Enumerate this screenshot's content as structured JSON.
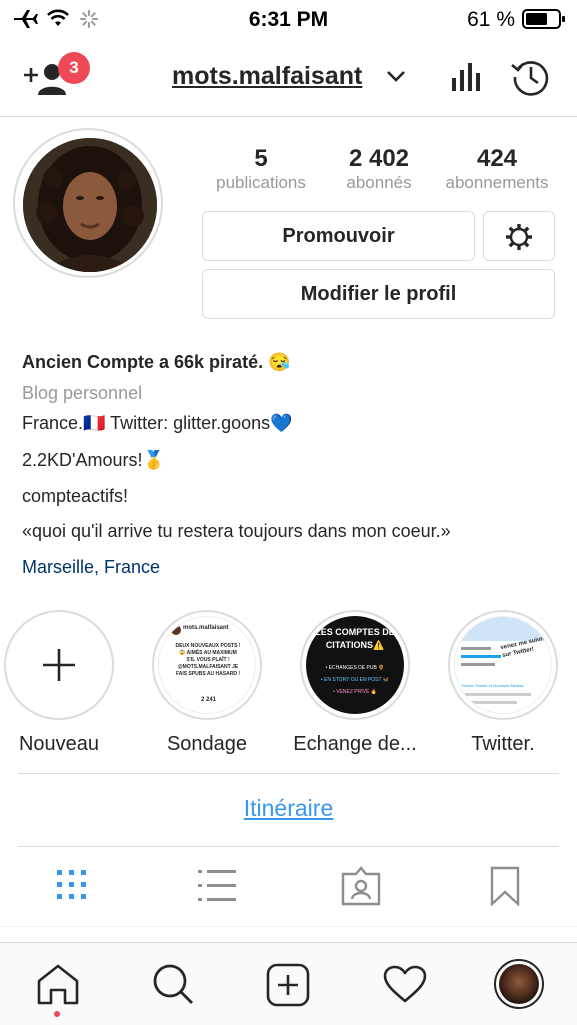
{
  "status_bar": {
    "time": "6:31 PM",
    "battery": "61 %"
  },
  "header": {
    "username": "mots.malfaisant",
    "notification_count": "3"
  },
  "profile": {
    "stats": [
      {
        "value": "5",
        "label": "publications"
      },
      {
        "value": "2 402",
        "label": "abonnés"
      },
      {
        "value": "424",
        "label": "abonnements"
      }
    ],
    "promote_label": "Promouvoir",
    "edit_profile_label": "Modifier le profil"
  },
  "bio": {
    "name": "Ancien Compte a 66k piraté. 😪",
    "category": "Blog personnel",
    "line1": "France.🇫🇷 Twitter: glitter.goons💙",
    "line2": "2.2KD'Amours!🥇",
    "line3": "compteactifs!",
    "line4": "«quoi qu'il arrive tu restera toujours dans mon coeur.»",
    "location": "Marseille, France"
  },
  "highlights": [
    {
      "label": "Nouveau"
    },
    {
      "label": "Sondage",
      "thumb_title": "mots.malfaisant",
      "thumb_text": "DEUX NOUVEAUX POSTS ! 😱 AIMÉS AU MAXIMUM S'IL VOUS PLAÎT ! @MOTS.MALFAISANT JE FAIS SPUBS AU HASARD !",
      "thumb_count": "2 241"
    },
    {
      "label": "Echange de...",
      "thumb_header": "LES COMPTES DE CITATIONS⚠️",
      "thumb_items": [
        "• ECHANGES DE PUB 🌻",
        "• EN STORY OU EN POST 🦋",
        "• VENEZ PRIVÉ 🔥"
      ]
    },
    {
      "label": "Twitter.",
      "thumb_text": "venez me suivre sur Twitter!",
      "thumb_tabs": [
        "Tweets",
        "Tweets et réponses",
        "Médias"
      ]
    }
  ],
  "link": {
    "label": "Itinéraire"
  },
  "colors": {
    "accent": "#3897f0",
    "link": "#003569",
    "badge": "#ed4956"
  }
}
